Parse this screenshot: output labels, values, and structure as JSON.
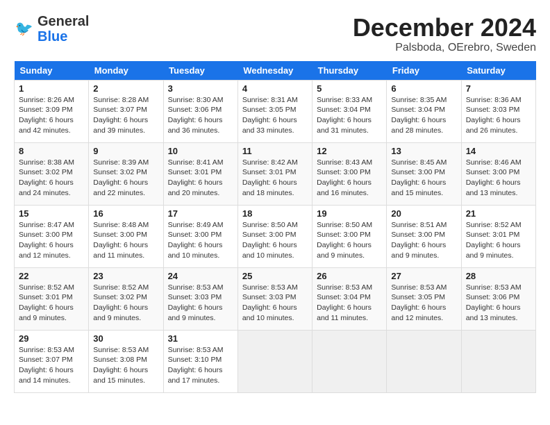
{
  "header": {
    "logo": {
      "line1": "General",
      "line2": "Blue"
    },
    "title": "December 2024",
    "location": "Palsboda, OErebro, Sweden"
  },
  "days_of_week": [
    "Sunday",
    "Monday",
    "Tuesday",
    "Wednesday",
    "Thursday",
    "Friday",
    "Saturday"
  ],
  "weeks": [
    [
      {
        "day": "1",
        "sunrise": "8:26 AM",
        "sunset": "3:09 PM",
        "daylight": "6 hours and 42 minutes."
      },
      {
        "day": "2",
        "sunrise": "8:28 AM",
        "sunset": "3:07 PM",
        "daylight": "6 hours and 39 minutes."
      },
      {
        "day": "3",
        "sunrise": "8:30 AM",
        "sunset": "3:06 PM",
        "daylight": "6 hours and 36 minutes."
      },
      {
        "day": "4",
        "sunrise": "8:31 AM",
        "sunset": "3:05 PM",
        "daylight": "6 hours and 33 minutes."
      },
      {
        "day": "5",
        "sunrise": "8:33 AM",
        "sunset": "3:04 PM",
        "daylight": "6 hours and 31 minutes."
      },
      {
        "day": "6",
        "sunrise": "8:35 AM",
        "sunset": "3:04 PM",
        "daylight": "6 hours and 28 minutes."
      },
      {
        "day": "7",
        "sunrise": "8:36 AM",
        "sunset": "3:03 PM",
        "daylight": "6 hours and 26 minutes."
      }
    ],
    [
      {
        "day": "8",
        "sunrise": "8:38 AM",
        "sunset": "3:02 PM",
        "daylight": "6 hours and 24 minutes."
      },
      {
        "day": "9",
        "sunrise": "8:39 AM",
        "sunset": "3:02 PM",
        "daylight": "6 hours and 22 minutes."
      },
      {
        "day": "10",
        "sunrise": "8:41 AM",
        "sunset": "3:01 PM",
        "daylight": "6 hours and 20 minutes."
      },
      {
        "day": "11",
        "sunrise": "8:42 AM",
        "sunset": "3:01 PM",
        "daylight": "6 hours and 18 minutes."
      },
      {
        "day": "12",
        "sunrise": "8:43 AM",
        "sunset": "3:00 PM",
        "daylight": "6 hours and 16 minutes."
      },
      {
        "day": "13",
        "sunrise": "8:45 AM",
        "sunset": "3:00 PM",
        "daylight": "6 hours and 15 minutes."
      },
      {
        "day": "14",
        "sunrise": "8:46 AM",
        "sunset": "3:00 PM",
        "daylight": "6 hours and 13 minutes."
      }
    ],
    [
      {
        "day": "15",
        "sunrise": "8:47 AM",
        "sunset": "3:00 PM",
        "daylight": "6 hours and 12 minutes."
      },
      {
        "day": "16",
        "sunrise": "8:48 AM",
        "sunset": "3:00 PM",
        "daylight": "6 hours and 11 minutes."
      },
      {
        "day": "17",
        "sunrise": "8:49 AM",
        "sunset": "3:00 PM",
        "daylight": "6 hours and 10 minutes."
      },
      {
        "day": "18",
        "sunrise": "8:50 AM",
        "sunset": "3:00 PM",
        "daylight": "6 hours and 10 minutes."
      },
      {
        "day": "19",
        "sunrise": "8:50 AM",
        "sunset": "3:00 PM",
        "daylight": "6 hours and 9 minutes."
      },
      {
        "day": "20",
        "sunrise": "8:51 AM",
        "sunset": "3:00 PM",
        "daylight": "6 hours and 9 minutes."
      },
      {
        "day": "21",
        "sunrise": "8:52 AM",
        "sunset": "3:01 PM",
        "daylight": "6 hours and 9 minutes."
      }
    ],
    [
      {
        "day": "22",
        "sunrise": "8:52 AM",
        "sunset": "3:01 PM",
        "daylight": "6 hours and 9 minutes."
      },
      {
        "day": "23",
        "sunrise": "8:52 AM",
        "sunset": "3:02 PM",
        "daylight": "6 hours and 9 minutes."
      },
      {
        "day": "24",
        "sunrise": "8:53 AM",
        "sunset": "3:03 PM",
        "daylight": "6 hours and 9 minutes."
      },
      {
        "day": "25",
        "sunrise": "8:53 AM",
        "sunset": "3:03 PM",
        "daylight": "6 hours and 10 minutes."
      },
      {
        "day": "26",
        "sunrise": "8:53 AM",
        "sunset": "3:04 PM",
        "daylight": "6 hours and 11 minutes."
      },
      {
        "day": "27",
        "sunrise": "8:53 AM",
        "sunset": "3:05 PM",
        "daylight": "6 hours and 12 minutes."
      },
      {
        "day": "28",
        "sunrise": "8:53 AM",
        "sunset": "3:06 PM",
        "daylight": "6 hours and 13 minutes."
      }
    ],
    [
      {
        "day": "29",
        "sunrise": "8:53 AM",
        "sunset": "3:07 PM",
        "daylight": "6 hours and 14 minutes."
      },
      {
        "day": "30",
        "sunrise": "8:53 AM",
        "sunset": "3:08 PM",
        "daylight": "6 hours and 15 minutes."
      },
      {
        "day": "31",
        "sunrise": "8:53 AM",
        "sunset": "3:10 PM",
        "daylight": "6 hours and 17 minutes."
      },
      null,
      null,
      null,
      null
    ]
  ],
  "labels": {
    "sunrise": "Sunrise:",
    "sunset": "Sunset:",
    "daylight": "Daylight:"
  }
}
